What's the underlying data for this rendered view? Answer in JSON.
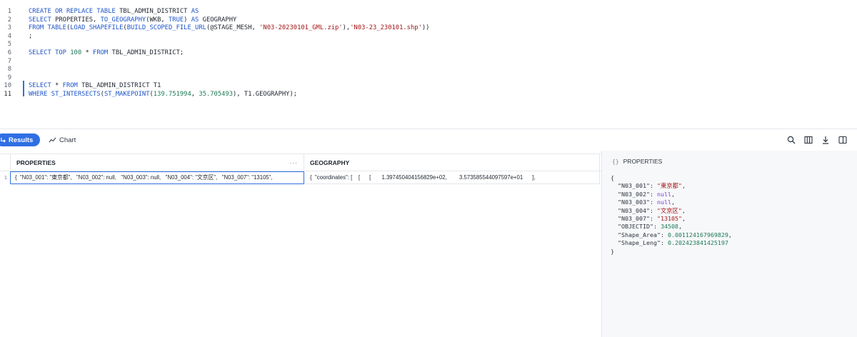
{
  "editor": {
    "line_numbers": [
      "1",
      "2",
      "3",
      "4",
      "5",
      "6",
      "7",
      "8",
      "9",
      "10",
      "11"
    ],
    "lines": [
      [
        {
          "t": "CREATE OR REPLACE TABLE ",
          "c": "k"
        },
        {
          "t": "TBL_ADMIN_DISTRICT ",
          "c": "p"
        },
        {
          "t": "AS",
          "c": "k"
        }
      ],
      [
        {
          "t": "SELECT ",
          "c": "k"
        },
        {
          "t": "PROPERTIES, ",
          "c": "p"
        },
        {
          "t": "TO_GEOGRAPHY",
          "c": "f"
        },
        {
          "t": "(WKB, ",
          "c": "p"
        },
        {
          "t": "TRUE",
          "c": "k"
        },
        {
          "t": ") ",
          "c": "p"
        },
        {
          "t": "AS ",
          "c": "k"
        },
        {
          "t": "GEOGRAPHY",
          "c": "p"
        }
      ],
      [
        {
          "t": "FROM TABLE",
          "c": "k"
        },
        {
          "t": "(",
          "c": "p"
        },
        {
          "t": "LOAD_SHAPEFILE",
          "c": "f"
        },
        {
          "t": "(",
          "c": "p"
        },
        {
          "t": "BUILD_SCOPED_FILE_URL",
          "c": "f"
        },
        {
          "t": "(@STAGE_MESH, ",
          "c": "p"
        },
        {
          "t": "'N03-20230101_GML.zip'",
          "c": "s"
        },
        {
          "t": "),",
          "c": "p"
        },
        {
          "t": "'N03-23_230101.shp'",
          "c": "s"
        },
        {
          "t": "))",
          "c": "p"
        }
      ],
      [
        {
          "t": ";",
          "c": "p"
        }
      ],
      [],
      [
        {
          "t": "SELECT TOP ",
          "c": "k"
        },
        {
          "t": "100",
          "c": "n"
        },
        {
          "t": " * ",
          "c": "p"
        },
        {
          "t": "FROM ",
          "c": "k"
        },
        {
          "t": "TBL_ADMIN_DISTRICT;",
          "c": "p"
        }
      ],
      [],
      [],
      [],
      [
        {
          "t": "SELECT ",
          "c": "k"
        },
        {
          "t": "* ",
          "c": "p"
        },
        {
          "t": "FROM ",
          "c": "k"
        },
        {
          "t": "TBL_ADMIN_DISTRICT T1",
          "c": "p"
        }
      ],
      [
        {
          "t": "WHERE ",
          "c": "k"
        },
        {
          "t": "ST_INTERSECTS",
          "c": "f"
        },
        {
          "t": "(",
          "c": "p"
        },
        {
          "t": "ST_MAKEPOINT",
          "c": "f"
        },
        {
          "t": "(",
          "c": "p"
        },
        {
          "t": "139.751994",
          "c": "n"
        },
        {
          "t": ", ",
          "c": "p"
        },
        {
          "t": "35.705493",
          "c": "n"
        },
        {
          "t": "), T1.GEOGRAPHY);",
          "c": "p"
        }
      ]
    ]
  },
  "toolbar": {
    "results_label": "Results",
    "chart_label": "Chart",
    "icons": [
      "search-icon",
      "columns-icon",
      "download-icon",
      "split-view-icon"
    ]
  },
  "grid": {
    "columns": [
      "PROPERTIES",
      "GEOGRAPHY"
    ],
    "column_menu": "···",
    "rows": [
      {
        "num": "1",
        "properties": "{  \"N03_001\": \"東京都\",   \"N03_002\": null,   \"N03_003\": null,   \"N03_004\": \"文京区\",   \"N03_007\": \"13105\",",
        "geography": "{  \"coordinates\": [    [      [       1.397450404156829e+02,        3.573585544097597e+01      ],"
      }
    ]
  },
  "detail": {
    "title": "PROPERTIES",
    "badge": "{}",
    "open_brace": "{",
    "close_brace": "}",
    "entries": [
      {
        "key": "\"N03_001\"",
        "value": "\"東京都\"",
        "type": "str"
      },
      {
        "key": "\"N03_002\"",
        "value": "null",
        "type": "null"
      },
      {
        "key": "\"N03_003\"",
        "value": "null",
        "type": "null"
      },
      {
        "key": "\"N03_004\"",
        "value": "\"文京区\"",
        "type": "str"
      },
      {
        "key": "\"N03_007\"",
        "value": "\"13105\"",
        "type": "str"
      },
      {
        "key": "\"OBJECTID\"",
        "value": "34508",
        "type": "num"
      },
      {
        "key": "\"Shape_Area\"",
        "value": "0.001124167969829",
        "type": "num"
      },
      {
        "key": "\"Shape_Leng\"",
        "value": "0.202423841425197",
        "type": "num"
      }
    ]
  }
}
